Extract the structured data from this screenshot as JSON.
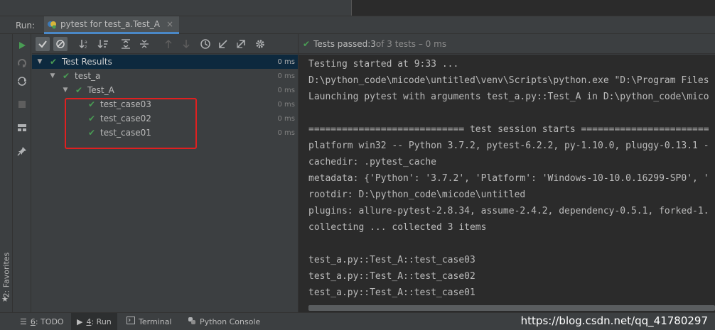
{
  "run_panel": {
    "label": "Run:",
    "tab_title": "pytest for test_a.Test_A",
    "tab_close": "×"
  },
  "favorites": {
    "label": "2: Favorites",
    "star": "★"
  },
  "status": {
    "prefix": "Tests passed: ",
    "passed": "3",
    "of": " of 3 tests – 0 ms"
  },
  "tree": {
    "root": {
      "label": "Test Results",
      "time": "0 ms"
    },
    "module": {
      "label": "test_a",
      "time": "0 ms"
    },
    "klass": {
      "label": "Test_A",
      "time": "0 ms"
    },
    "cases": [
      {
        "label": "test_case03",
        "time": "0 ms"
      },
      {
        "label": "test_case02",
        "time": "0 ms"
      },
      {
        "label": "test_case01",
        "time": "0 ms"
      }
    ]
  },
  "console": {
    "lines": [
      "Testing started at 9:33 ...",
      "D:\\python_code\\micode\\untitled\\venv\\Scripts\\python.exe \"D:\\Program Files",
      "Launching pytest with arguments test_a.py::Test_A in D:\\python_code\\mico",
      "",
      "============================ test session starts =======================",
      "platform win32 -- Python 3.7.2, pytest-6.2.2, py-1.10.0, pluggy-0.13.1 -",
      "cachedir: .pytest_cache",
      "metadata: {'Python': '3.7.2', 'Platform': 'Windows-10-10.0.16299-SP0', '",
      "rootdir: D:\\python_code\\micode\\untitled",
      "plugins: allure-pytest-2.8.34, assume-2.4.2, dependency-0.5.1, forked-1.",
      "collecting ... collected 3 items",
      "",
      "test_a.py::Test_A::test_case03",
      "test_a.py::Test_A::test_case02",
      "test_a.py::Test_A::test_case01"
    ]
  },
  "bottom_tabs": {
    "todo_num": "6",
    "todo_label": ": TODO",
    "run_num": "4",
    "run_label": ": Run",
    "terminal": "Terminal",
    "python_console": "Python Console"
  },
  "watermark": "https://blog.csdn.net/qq_41780297",
  "colors": {
    "pass_green": "#499c54",
    "selection": "#0d293e",
    "highlight_red": "#e02020"
  }
}
